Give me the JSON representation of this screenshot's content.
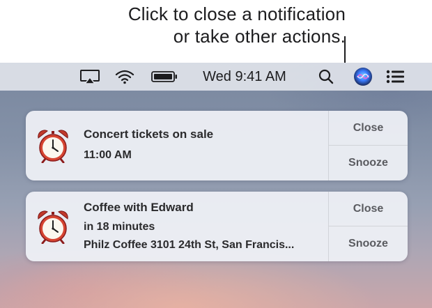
{
  "callout": {
    "line1": "Click to close a notification",
    "line2": "or take other actions."
  },
  "menubar": {
    "icons": [
      "airplay-icon",
      "wifi-icon",
      "battery-icon",
      "spotlight-search-icon",
      "siri-icon",
      "notification-center-icon"
    ],
    "clock": "Wed 9:41 AM"
  },
  "notifications": [
    {
      "app_icon": "alarm-clock-icon",
      "title": "Concert tickets on sale",
      "subtitle": "11:00 AM",
      "actions": [
        "Close",
        "Snooze"
      ]
    },
    {
      "app_icon": "alarm-clock-icon",
      "title": "Coffee with Edward",
      "subtitle": "in 18 minutes",
      "location": "Philz Coffee 3101 24th St, San Francis...",
      "actions": [
        "Close",
        "Snooze"
      ]
    }
  ],
  "colors": {
    "menubar": "#dfe2e9",
    "notification_bg": "#eef0f5",
    "text": "#2a2a2c",
    "action_text": "#5a5b60",
    "siri_accent": "#3a7bff"
  }
}
